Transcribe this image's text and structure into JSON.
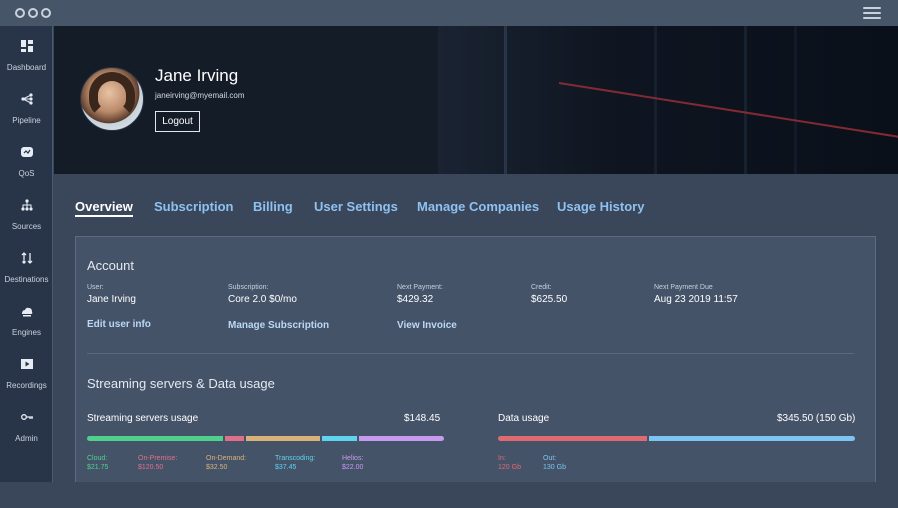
{
  "sidebar": {
    "items": [
      {
        "label": "Dashboard",
        "icon": "dashboard-icon"
      },
      {
        "label": "Pipeline",
        "icon": "pipeline-icon"
      },
      {
        "label": "QoS",
        "icon": "qos-icon"
      },
      {
        "label": "Sources",
        "icon": "sources-icon"
      },
      {
        "label": "Destinations",
        "icon": "destinations-icon"
      },
      {
        "label": "Engines",
        "icon": "engines-icon"
      },
      {
        "label": "Recordings",
        "icon": "recordings-icon"
      },
      {
        "label": "Admin",
        "icon": "admin-key-icon"
      }
    ]
  },
  "profile": {
    "name": "Jane Irving",
    "email": "janeirving@myemail.com",
    "logout_label": "Logout"
  },
  "tabs": [
    {
      "label": "Overview",
      "active": true
    },
    {
      "label": "Subscription",
      "active": false
    },
    {
      "label": "Billing",
      "active": false
    },
    {
      "label": "User Settings",
      "active": false
    },
    {
      "label": "Manage Companies",
      "active": false
    },
    {
      "label": "Usage History",
      "active": false
    }
  ],
  "account": {
    "title": "Account",
    "user": {
      "label": "User:",
      "value": "Jane Irving"
    },
    "subscription": {
      "label": "Subscription:",
      "value": "Core 2.0 $0/mo"
    },
    "next_payment": {
      "label": "Next Payment:",
      "value": "$429.32"
    },
    "credit": {
      "label": "Credit:",
      "value": "$625.50"
    },
    "next_payment_due": {
      "label": "Next Payment Due",
      "value": "Aug 23 2019 11:57"
    },
    "links": {
      "edit_user": "Edit user info",
      "manage_subscription": "Manage Subscription",
      "view_invoice": "View Invoice"
    }
  },
  "usage": {
    "title": "Streaming servers & Data usage",
    "streaming": {
      "label": "Streaming servers usage",
      "total": "$148.45",
      "segments": [
        {
          "name": "Cloud:",
          "value": "$21.75",
          "color": "#4fd08d",
          "share": 0.35
        },
        {
          "name": "On-Premise:",
          "value": "$120.50",
          "color": "#e0708a",
          "share": 0.05
        },
        {
          "name": "On-Demand:",
          "value": "$32.50",
          "color": "#d9b27a",
          "share": 0.19
        },
        {
          "name": "Transcoding:",
          "value": "$37.45",
          "color": "#5fd4ee",
          "share": 0.09
        },
        {
          "name": "Helios:",
          "value": "$22.00",
          "color": "#c79af0",
          "share": 0.22
        }
      ]
    },
    "data": {
      "label": "Data usage",
      "total": "$345.50 (150 Gb)",
      "segments": [
        {
          "name": "In:",
          "value": "120 Gb",
          "color": "#e06a72",
          "share": 0.42
        },
        {
          "name": "Out:",
          "value": "130 Gb",
          "color": "#7cc4f2",
          "share": 0.58
        }
      ]
    }
  }
}
